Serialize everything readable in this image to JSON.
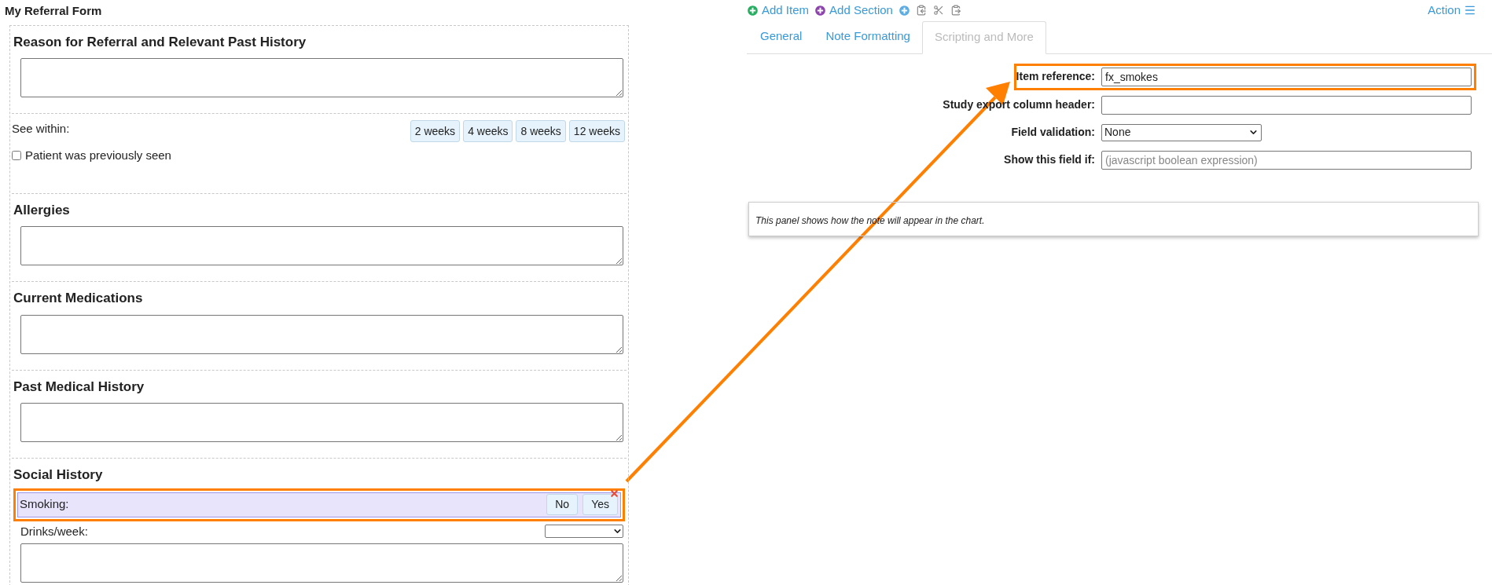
{
  "title": "My Referral Form",
  "sections": [
    {
      "kind": "textarea",
      "heading": "Reason for Referral and Relevant Past History"
    },
    {
      "kind": "choices",
      "label": "See within:",
      "options": [
        "2 weeks",
        "4 weeks",
        "8 weeks",
        "12 weeks"
      ],
      "checkbox": {
        "label": "Patient was previously seen",
        "checked": false
      }
    },
    {
      "kind": "textarea",
      "heading": "Allergies"
    },
    {
      "kind": "textarea",
      "heading": "Current Medications"
    },
    {
      "kind": "textarea",
      "heading": "Past Medical History"
    },
    {
      "kind": "social",
      "heading": "Social History",
      "item": {
        "label": "Smoking:",
        "options": [
          "No",
          "Yes"
        ],
        "highlighted": true
      },
      "select_label": "Drinks/week:"
    }
  ],
  "toolbar": {
    "add_item": "Add Item",
    "add_section": "Add Section",
    "action": "Action"
  },
  "tabs": [
    {
      "label": "General",
      "selected": false
    },
    {
      "label": "Note Formatting",
      "selected": false
    },
    {
      "label": "Scripting and More",
      "selected": true
    }
  ],
  "fields": [
    {
      "kind": "input",
      "label": "Item reference:",
      "value": "fx_smokes",
      "highlighted": true
    },
    {
      "kind": "input",
      "label": "Study export column header:",
      "highlighted": false
    },
    {
      "kind": "select",
      "label": "Field validation:",
      "value": "None",
      "highlighted": false
    },
    {
      "kind": "input",
      "label": "Show this field if:",
      "placeholder": "(javascript boolean expression)",
      "highlighted": false
    }
  ],
  "note": "This panel shows how the note will appear in the chart."
}
